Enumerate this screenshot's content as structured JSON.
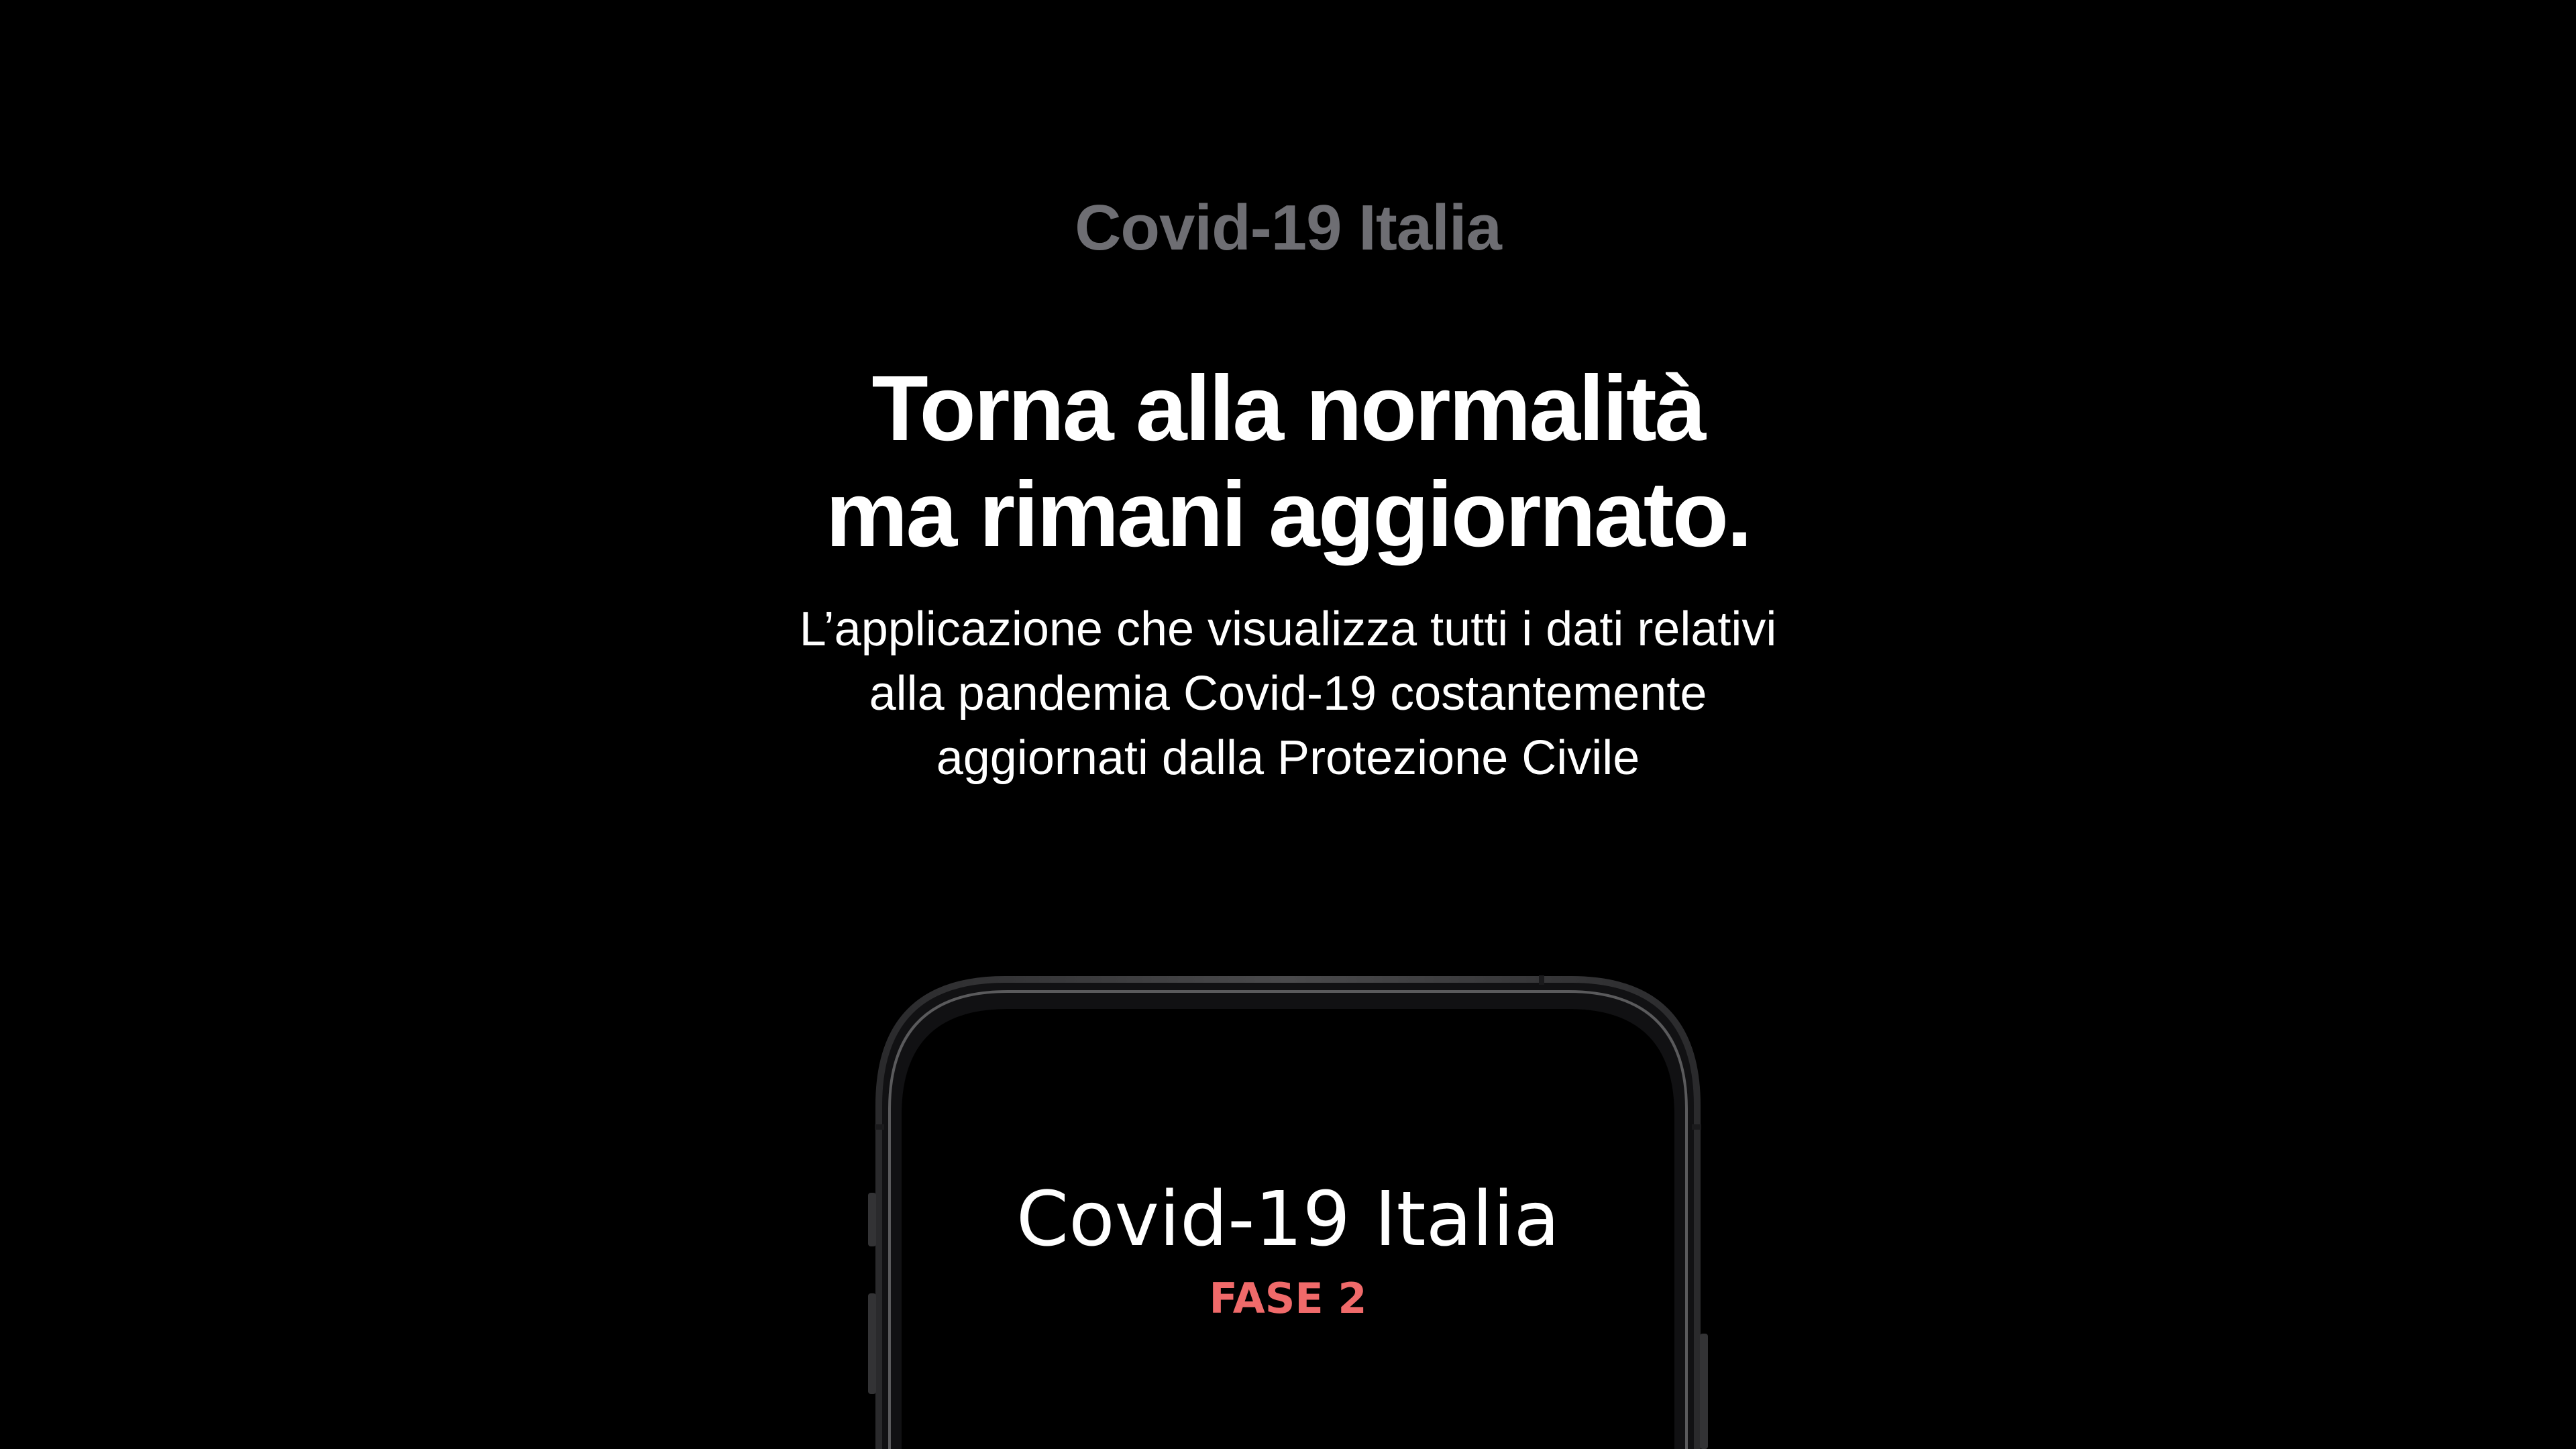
{
  "hero": {
    "eyebrow": "Covid-19 Italia",
    "headline": [
      "Torna alla normalità",
      "ma rimani aggiornato."
    ],
    "description": [
      "L’applicazione che visualizza tutti i dati relativi",
      "alla pandemia Covid-19 costantemente",
      "aggiornati dalla Protezione Civile"
    ]
  },
  "phone": {
    "app_title": "Covid-19 Italia",
    "app_phase": "FASE 2",
    "phase_color": "#f06a6a"
  },
  "colors": {
    "background": "#000000",
    "eyebrow": "#6e6e73",
    "text": "#ffffff",
    "device_frame": "#3a3a3c"
  }
}
